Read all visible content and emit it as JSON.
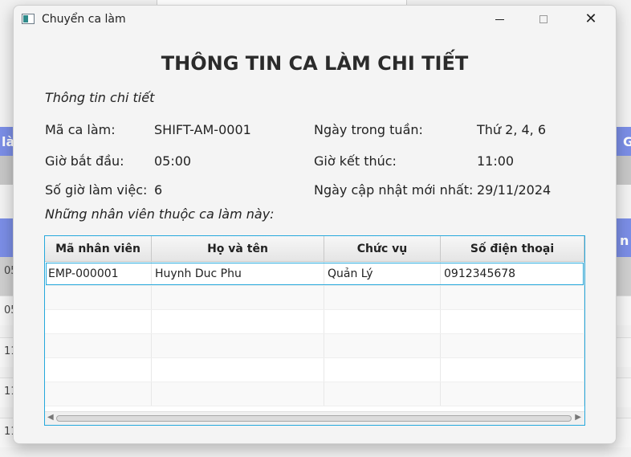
{
  "window": {
    "title": "Chuyển ca làm"
  },
  "heading": "THÔNG TIN CA LÀM CHI TIẾT",
  "section_title": "Thông tin chi tiết",
  "details": {
    "shift_code_label": "Mã ca làm:",
    "shift_code_value": "SHIFT-AM-0001",
    "weekdays_label": "Ngày trong tuần:",
    "weekdays_value": "Thứ 2, 4, 6",
    "start_label": "Giờ bắt đầu:",
    "start_value": "05:00",
    "end_label": "Giờ kết thúc:",
    "end_value": "11:00",
    "hours_label": "Số giờ làm việc:",
    "hours_value": "6",
    "updated_label": "Ngày cập nhật mới nhất:",
    "updated_value": "29/11/2024"
  },
  "staff_label": "Những nhân viên thuộc ca làm này:",
  "table": {
    "columns": [
      "Mã nhân viên",
      "Họ và tên",
      "Chức vụ",
      "Số điện thoại"
    ],
    "rows": [
      [
        "EMP-000001",
        "Huynh Duc Phu",
        "Quản Lý",
        "0912345678"
      ]
    ]
  },
  "background": {
    "left_fragments": [
      "là",
      "05",
      "05",
      "11",
      "11",
      "11"
    ],
    "right_fragments": [
      "G",
      "n"
    ]
  },
  "colors": {
    "accent": "#25a8dc",
    "background_header": "#7b8ee6"
  }
}
